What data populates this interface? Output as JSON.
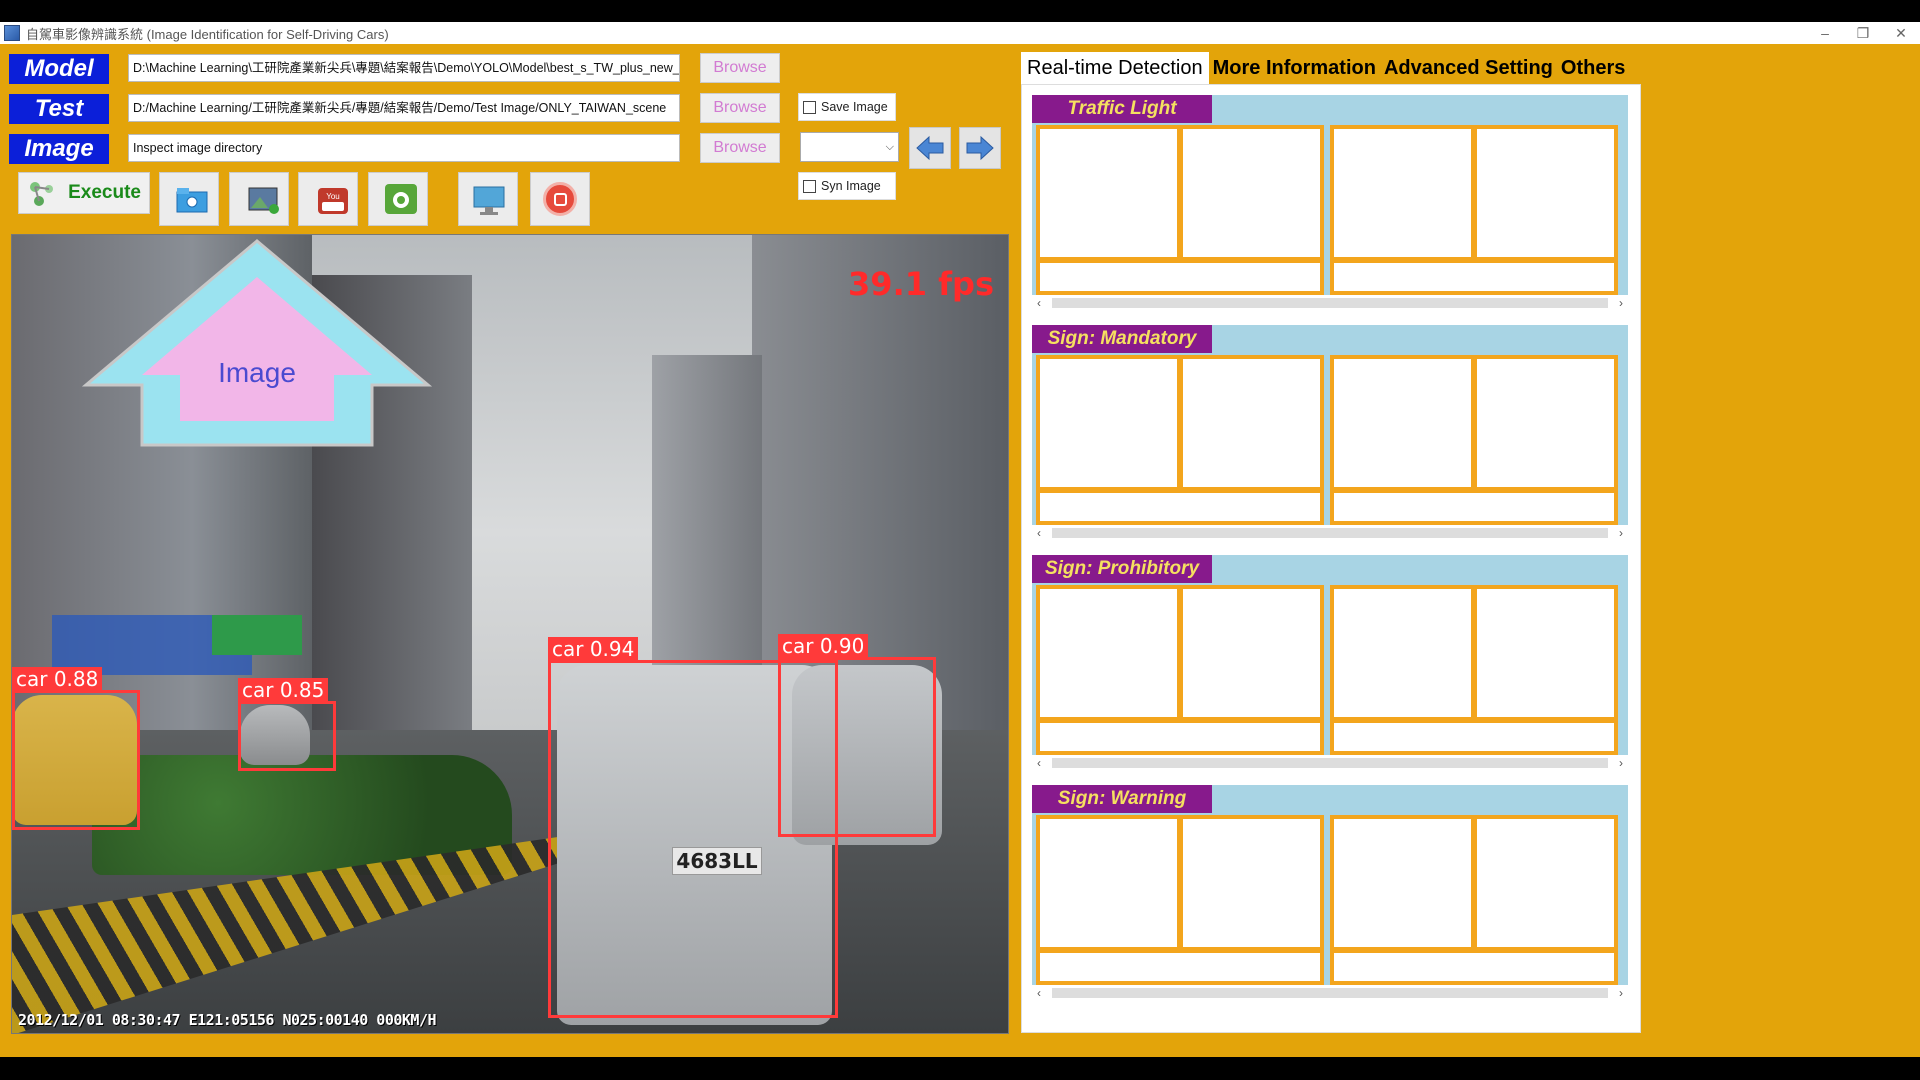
{
  "window": {
    "title": "自駕車影像辨識系統 (Image Identification for Self-Driving Cars)",
    "controls": [
      "–",
      "❐",
      "✕"
    ]
  },
  "rows": [
    {
      "label": "Model",
      "path": "D:\\Machine Learning\\工研院產業新尖兵\\專題\\結案報告\\Demo\\YOLO\\Model\\best_s_TW_plus_new_",
      "browse": "Browse"
    },
    {
      "label": "Test",
      "path": "D:/Machine Learning/工研院產業新尖兵/專題/結案報告/Demo/Test Image/ONLY_TAIWAN_scene",
      "browse": "Browse"
    },
    {
      "label": "Image",
      "path": "Inspect image directory",
      "browse": "Browse"
    }
  ],
  "checkboxes": {
    "save_image": {
      "label": "Save Image",
      "checked": false
    },
    "syn_image": {
      "label": "Syn Image",
      "checked": false
    }
  },
  "combo": {
    "value": ""
  },
  "toolbar": {
    "execute_label": "Execute",
    "sources": [
      {
        "name": "folder",
        "selected": true
      },
      {
        "name": "image",
        "selected": false
      },
      {
        "name": "youtube",
        "selected": false
      },
      {
        "name": "droidcam",
        "selected": false,
        "caption": "DroidCam"
      },
      {
        "name": "screen",
        "selected": false
      }
    ]
  },
  "viewport": {
    "fps": "39.1 fps",
    "overlay_text": "Image",
    "osd": "2012/12/01 08:30:47  E121:05156  N025:00140  000KM/H",
    "plate": "4683LL",
    "detections": [
      {
        "label": "car 0.88"
      },
      {
        "label": "car 0.85"
      },
      {
        "label": "car 0.94"
      },
      {
        "label": "car 0.90"
      }
    ]
  },
  "tabs": [
    {
      "label": "Real-time Detection",
      "active": true
    },
    {
      "label": "More Information",
      "active": false
    },
    {
      "label": "Advanced Setting",
      "active": false
    },
    {
      "label": "Others",
      "active": false
    }
  ],
  "categories": [
    {
      "title": "Traffic Light"
    },
    {
      "title": "Sign: Mandatory"
    },
    {
      "title": "Sign: Prohibitory"
    },
    {
      "title": "Sign: Warning"
    }
  ],
  "colors": {
    "background": "#e3a40a",
    "label_blue": "#0b1fd9",
    "category_header": "#871a8c",
    "category_text": "#f5e060",
    "detection_box": "#ff3a3a"
  }
}
